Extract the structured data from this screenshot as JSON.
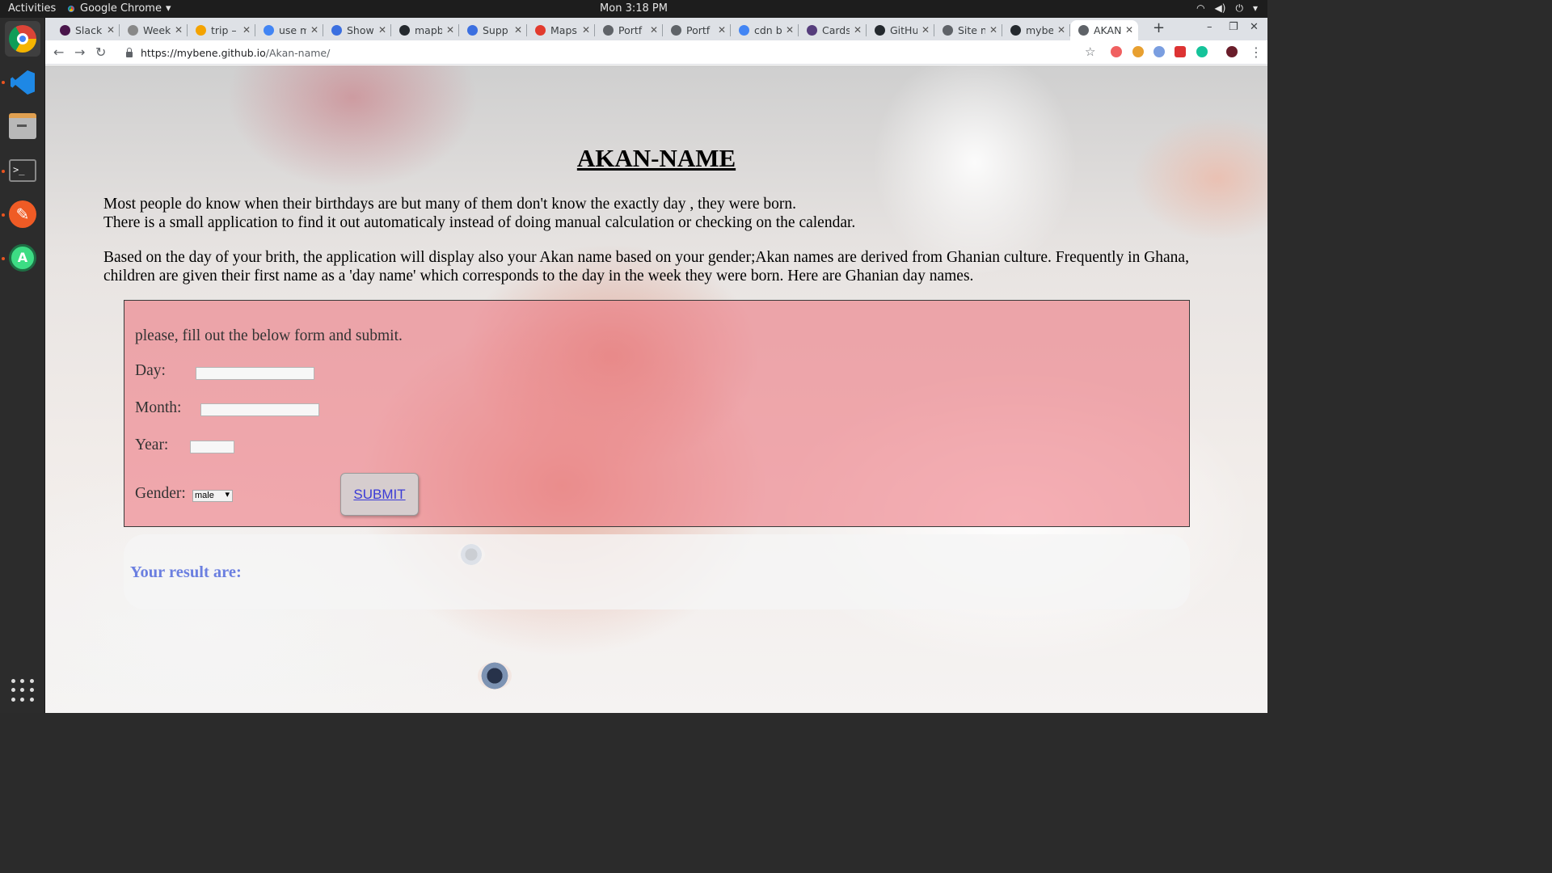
{
  "system": {
    "activities": "Activities",
    "app_menu": "Google Chrome",
    "clock": "Mon  3:18 PM"
  },
  "tabs": [
    {
      "title": "Slack",
      "color": "#4a154b"
    },
    {
      "title": "Week",
      "color": "#888888"
    },
    {
      "title": "trip –",
      "color": "#f4a300"
    },
    {
      "title": "use m",
      "color": "#4285f4"
    },
    {
      "title": "Show",
      "color": "#3b6fe0"
    },
    {
      "title": "mapb",
      "color": "#24292e"
    },
    {
      "title": "Supp",
      "color": "#3b6fe0"
    },
    {
      "title": "Maps",
      "color": "#e23b2e"
    },
    {
      "title": "Portf",
      "color": "#5f6368"
    },
    {
      "title": "Portf",
      "color": "#5f6368"
    },
    {
      "title": "cdn b",
      "color": "#4285f4"
    },
    {
      "title": "Cards",
      "color": "#563d7c"
    },
    {
      "title": "GitHu",
      "color": "#24292e"
    },
    {
      "title": "Site n",
      "color": "#5f6368"
    },
    {
      "title": "mybe",
      "color": "#24292e"
    },
    {
      "title": "AKAN",
      "color": "#5f6368",
      "active": true
    }
  ],
  "address": {
    "host": "https://mybene.github.io",
    "path": "/Akan-name/"
  },
  "page": {
    "title": "AKAN-NAME",
    "intro_line1": "Most people do know when their birthdays are but many of them don't know the exactly day , they were born.",
    "intro_line2": "There is a small application to find it out automaticaly instead of doing manual calculation or checking on the calendar.",
    "intro_para2": "Based on the day of your brith, the application will display also your Akan name based on your gender;Akan names are derived from Ghanian culture. Frequently in Ghana, children are given their first name as a 'day name' which corresponds to the day in the week they were born. Here are Ghanian day names.",
    "form": {
      "instruction": "please, fill out the below form and submit.",
      "day_label": "Day:",
      "month_label": "Month:",
      "year_label": "Year:",
      "gender_label": "Gender:",
      "gender_value": "male",
      "submit_label": "SUBMIT"
    },
    "result_label": "Your result are:"
  }
}
